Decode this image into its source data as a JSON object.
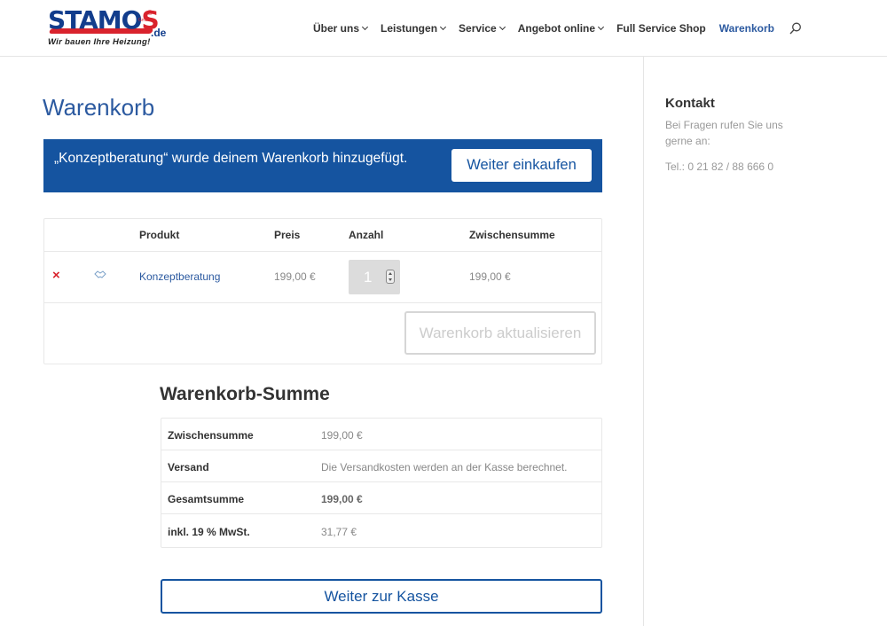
{
  "logo": {
    "name": "STAMOS",
    "domain": ".de",
    "tagline": "Wir bauen Ihre Heizung!"
  },
  "nav": {
    "items": [
      {
        "label": "Über uns",
        "dropdown": true
      },
      {
        "label": "Leistungen",
        "dropdown": true
      },
      {
        "label": "Service",
        "dropdown": true
      },
      {
        "label": "Angebot online",
        "dropdown": true
      },
      {
        "label": "Full Service Shop",
        "dropdown": false
      },
      {
        "label": "Warenkorb",
        "dropdown": false,
        "active": true
      }
    ]
  },
  "page": {
    "title": "Warenkorb"
  },
  "notice": {
    "message": "„Konzeptberatung“ wurde deinem Warenkorb hinzugefügt.",
    "button_label": "Weiter einkaufen"
  },
  "cart": {
    "headers": {
      "product": "Produkt",
      "price": "Preis",
      "quantity": "Anzahl",
      "subtotal": "Zwischensumme"
    },
    "rows": [
      {
        "remove": "×",
        "product": "Konzeptberatung",
        "price": "199,00 €",
        "quantity": "1",
        "subtotal": "199,00 €"
      }
    ],
    "update_label": "Warenkorb aktualisieren"
  },
  "totals": {
    "title": "Warenkorb-Summe",
    "rows": [
      {
        "label": "Zwischensumme",
        "value": "199,00 €"
      },
      {
        "label": "Versand",
        "value": "Die Versandkosten werden an der Kasse berechnet."
      },
      {
        "label": "Gesamtsumme",
        "value": "199,00 €"
      },
      {
        "label": "inkl. 19 % MwSt.",
        "value": "31,77 €"
      }
    ],
    "checkout_label": "Weiter zur Kasse"
  },
  "sidebar": {
    "title": "Kontakt",
    "text": "Bei Fragen rufen Sie uns gerne an:",
    "phone": "Tel.: 0 21 82 / 88 666 0"
  },
  "colors": {
    "brand_blue": "#1554a0",
    "link_blue": "#2c5aa0",
    "brand_red": "#d9232d"
  }
}
